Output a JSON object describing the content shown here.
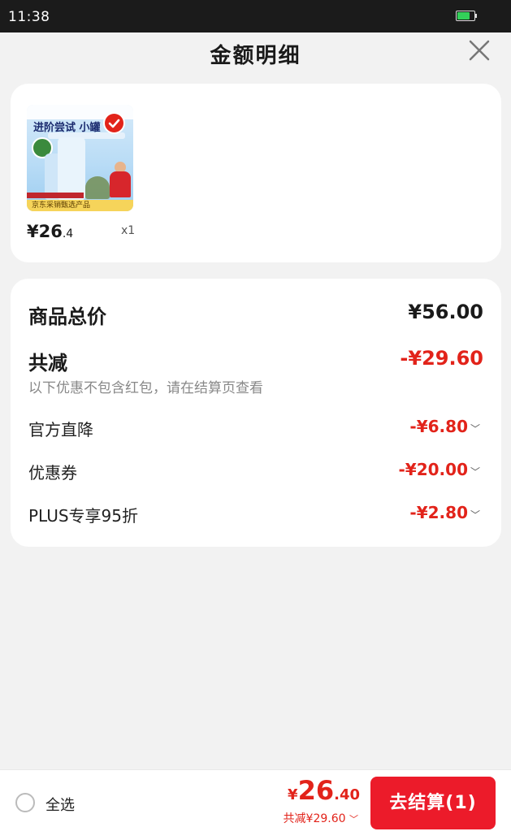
{
  "status_bar": {
    "time": "11:38",
    "battery_level": 0.8
  },
  "header": {
    "title": "金额明细"
  },
  "product": {
    "image_headline": "进阶尝试 小罐",
    "image_band": "京东采销甄选产品",
    "price_int": "¥26",
    "price_dec": ".4",
    "qty": "x1"
  },
  "summary": {
    "total_label": "商品总价",
    "total_value": "¥56.00",
    "reduce_label": "共减",
    "reduce_value": "-¥29.60",
    "note": "以下优惠不包含红包，请在结算页查看",
    "items": [
      {
        "label": "官方直降",
        "value": "-¥6.80"
      },
      {
        "label": "优惠券",
        "value": "-¥20.00"
      },
      {
        "label": "PLUS专享95折",
        "value": "-¥2.80"
      }
    ]
  },
  "bottom": {
    "select_all": "全选",
    "amount_sym": "¥",
    "amount_int": "26",
    "amount_dec": ".40",
    "discount_text": "共减¥29.60",
    "checkout_label": "去结算(1)"
  },
  "colors": {
    "accent_red": "#e2231a",
    "checkout_red": "#ec1b2a",
    "background": "#f2f2f2"
  },
  "icons": [
    "close-icon",
    "check-circle-icon",
    "chevron-down-icon",
    "radio-icon",
    "battery-icon"
  ]
}
